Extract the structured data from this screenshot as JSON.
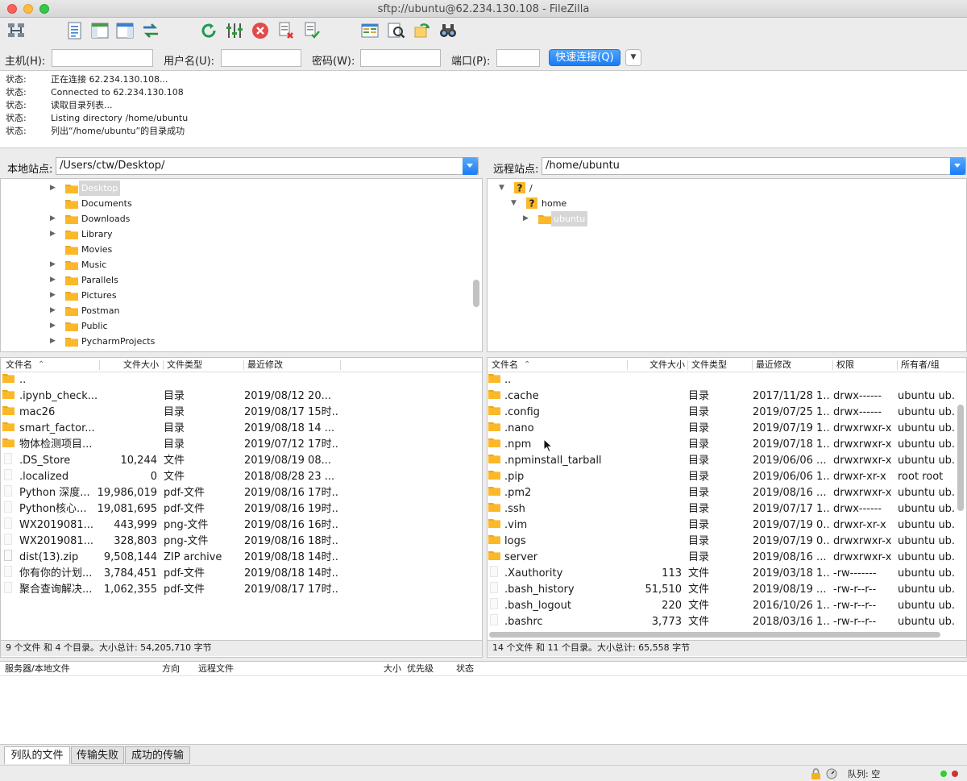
{
  "window": {
    "title": "sftp://ubuntu@62.234.130.108 - FileZilla"
  },
  "toolbar": {
    "icons": [
      "site-manager-icon",
      "message-log-icon",
      "local-tree-icon",
      "remote-tree-icon",
      "transfer-queue-icon",
      "refresh-icon",
      "filter-icon",
      "cancel-icon",
      "disconnect-icon",
      "reconnect-icon",
      "directory-compare-icon",
      "search-icon",
      "sync-browse-icon",
      "binoculars-icon"
    ]
  },
  "quickconnect": {
    "host_label": "主机(H):",
    "user_label": "用户名(U):",
    "pass_label": "密码(W):",
    "port_label": "端口(P):",
    "host_value": "",
    "user_value": "",
    "pass_value": "",
    "port_value": "",
    "connect_label": "快速连接(Q)"
  },
  "log": [
    {
      "k": "状态:",
      "v": "正在连接 62.234.130.108..."
    },
    {
      "k": "状态:",
      "v": "Connected to 62.234.130.108"
    },
    {
      "k": "状态:",
      "v": "读取目录列表..."
    },
    {
      "k": "状态:",
      "v": "Listing directory /home/ubuntu"
    },
    {
      "k": "状态:",
      "v": "列出“/home/ubuntu”的目录成功"
    }
  ],
  "local": {
    "site_label": "本地站点:",
    "path": "/Users/ctw/Desktop/",
    "tree": [
      {
        "name": "Desktop",
        "arrow": true,
        "selected": true
      },
      {
        "name": "Documents",
        "arrow": false
      },
      {
        "name": "Downloads",
        "arrow": true
      },
      {
        "name": "Library",
        "arrow": true
      },
      {
        "name": "Movies",
        "arrow": false
      },
      {
        "name": "Music",
        "arrow": true
      },
      {
        "name": "Parallels",
        "arrow": true
      },
      {
        "name": "Pictures",
        "arrow": true
      },
      {
        "name": "Postman",
        "arrow": true
      },
      {
        "name": "Public",
        "arrow": true
      },
      {
        "name": "PycharmProjects",
        "arrow": true
      }
    ],
    "headers": {
      "name": "文件名",
      "size": "文件大小",
      "type": "文件类型",
      "modified": "最近修改"
    },
    "files": [
      {
        "name": "..",
        "size": "",
        "type": "",
        "modified": "",
        "dir": true
      },
      {
        "name": ".ipynb_check...",
        "size": "",
        "type": "目录",
        "modified": "2019/08/12 20...",
        "dir": true
      },
      {
        "name": "mac26",
        "size": "",
        "type": "目录",
        "modified": "2019/08/17 15时...",
        "dir": true
      },
      {
        "name": "smart_factor...",
        "size": "",
        "type": "目录",
        "modified": "2019/08/18 14 ...",
        "dir": true
      },
      {
        "name": "物体检测项目...",
        "size": "",
        "type": "目录",
        "modified": "2019/07/12 17时...",
        "dir": true
      },
      {
        "name": ".DS_Store",
        "size": "10,244",
        "type": "文件",
        "modified": "2019/08/19 08...",
        "dir": false
      },
      {
        "name": ".localized",
        "size": "0",
        "type": "文件",
        "modified": "2018/08/28 23 ...",
        "dir": false
      },
      {
        "name": "Python 深度...",
        "size": "19,986,019",
        "type": "pdf-文件",
        "modified": "2019/08/16 17时...",
        "dir": false
      },
      {
        "name": "Python核心...",
        "size": "19,081,695",
        "type": "pdf-文件",
        "modified": "2019/08/16 19时...",
        "dir": false
      },
      {
        "name": "WX2019081...",
        "size": "443,999",
        "type": "png-文件",
        "modified": "2019/08/16 16时...",
        "dir": false
      },
      {
        "name": "WX2019081...",
        "size": "328,803",
        "type": "png-文件",
        "modified": "2019/08/16 18时...",
        "dir": false
      },
      {
        "name": "dist(13).zip",
        "size": "9,508,144",
        "type": "ZIP archive",
        "modified": "2019/08/18 14时...",
        "dir": false,
        "zip": true
      },
      {
        "name": "你有你的计划...",
        "size": "3,784,451",
        "type": "pdf-文件",
        "modified": "2019/08/18 14时...",
        "dir": false
      },
      {
        "name": "聚合查询解决...",
        "size": "1,062,355",
        "type": "pdf-文件",
        "modified": "2019/08/17 17时...",
        "dir": false
      }
    ],
    "summary": "9 个文件 和 4 个目录。大小总计: 54,205,710 字节"
  },
  "remote": {
    "site_label": "远程站点:",
    "path": "/home/ubuntu",
    "tree": [
      {
        "name": "/",
        "level": 0,
        "arrow": "down",
        "unknown": true
      },
      {
        "name": "home",
        "level": 1,
        "arrow": "down",
        "unknown": true
      },
      {
        "name": "ubuntu",
        "level": 2,
        "arrow": "right",
        "selected": true
      }
    ],
    "headers": {
      "name": "文件名",
      "size": "文件大小",
      "type": "文件类型",
      "modified": "最近修改",
      "perms": "权限",
      "owner": "所有者/组"
    },
    "files": [
      {
        "name": "..",
        "size": "",
        "type": "",
        "modified": "",
        "perms": "",
        "owner": "",
        "dir": true
      },
      {
        "name": ".cache",
        "size": "",
        "type": "目录",
        "modified": "2017/11/28 1...",
        "perms": "drwx------",
        "owner": "ubuntu ub...",
        "dir": true
      },
      {
        "name": ".config",
        "size": "",
        "type": "目录",
        "modified": "2019/07/25 1...",
        "perms": "drwx------",
        "owner": "ubuntu ub...",
        "dir": true
      },
      {
        "name": ".nano",
        "size": "",
        "type": "目录",
        "modified": "2019/07/19 1...",
        "perms": "drwxrwxr-x",
        "owner": "ubuntu ub...",
        "dir": true
      },
      {
        "name": ".npm",
        "size": "",
        "type": "目录",
        "modified": "2019/07/18 1...",
        "perms": "drwxrwxr-x",
        "owner": "ubuntu ub...",
        "dir": true
      },
      {
        "name": ".npminstall_tarball",
        "size": "",
        "type": "目录",
        "modified": "2019/06/06 ...",
        "perms": "drwxrwxr-x",
        "owner": "ubuntu ub...",
        "dir": true
      },
      {
        "name": ".pip",
        "size": "",
        "type": "目录",
        "modified": "2019/06/06 1...",
        "perms": "drwxr-xr-x",
        "owner": "root root",
        "dir": true
      },
      {
        "name": ".pm2",
        "size": "",
        "type": "目录",
        "modified": "2019/08/16 ...",
        "perms": "drwxrwxr-x",
        "owner": "ubuntu ub...",
        "dir": true
      },
      {
        "name": ".ssh",
        "size": "",
        "type": "目录",
        "modified": "2019/07/17 1...",
        "perms": "drwx------",
        "owner": "ubuntu ub...",
        "dir": true
      },
      {
        "name": ".vim",
        "size": "",
        "type": "目录",
        "modified": "2019/07/19 0...",
        "perms": "drwxr-xr-x",
        "owner": "ubuntu ub...",
        "dir": true
      },
      {
        "name": "logs",
        "size": "",
        "type": "目录",
        "modified": "2019/07/19 0...",
        "perms": "drwxrwxr-x",
        "owner": "ubuntu ub...",
        "dir": true
      },
      {
        "name": "server",
        "size": "",
        "type": "目录",
        "modified": "2019/08/16 ...",
        "perms": "drwxrwxr-x",
        "owner": "ubuntu ub...",
        "dir": true
      },
      {
        "name": ".Xauthority",
        "size": "113",
        "type": "文件",
        "modified": "2019/03/18 1...",
        "perms": "-rw-------",
        "owner": "ubuntu ub...",
        "dir": false
      },
      {
        "name": ".bash_history",
        "size": "51,510",
        "type": "文件",
        "modified": "2019/08/19 ...",
        "perms": "-rw-r--r--",
        "owner": "ubuntu ub...",
        "dir": false
      },
      {
        "name": ".bash_logout",
        "size": "220",
        "type": "文件",
        "modified": "2016/10/26 1...",
        "perms": "-rw-r--r--",
        "owner": "ubuntu ub...",
        "dir": false
      },
      {
        "name": ".bashrc",
        "size": "3,773",
        "type": "文件",
        "modified": "2018/03/16 1...",
        "perms": "-rw-r--r--",
        "owner": "ubuntu ub...",
        "dir": false
      }
    ],
    "summary": "14 个文件 和 11 个目录。大小总计: 65,558 字节"
  },
  "queue": {
    "headers": {
      "server": "服务器/本地文件",
      "direction": "方向",
      "remote": "远程文件",
      "size": "大小",
      "priority": "优先级",
      "status": "状态"
    },
    "tabs": [
      "列队的文件",
      "传输失败",
      "成功的传输"
    ]
  },
  "statusbar": {
    "queue": "队列: 空"
  },
  "colors": {
    "accent": "#1a7cf4",
    "folder": "#fbb829",
    "cancel": "#e14b4b",
    "refresh": "#2a9d3c"
  }
}
